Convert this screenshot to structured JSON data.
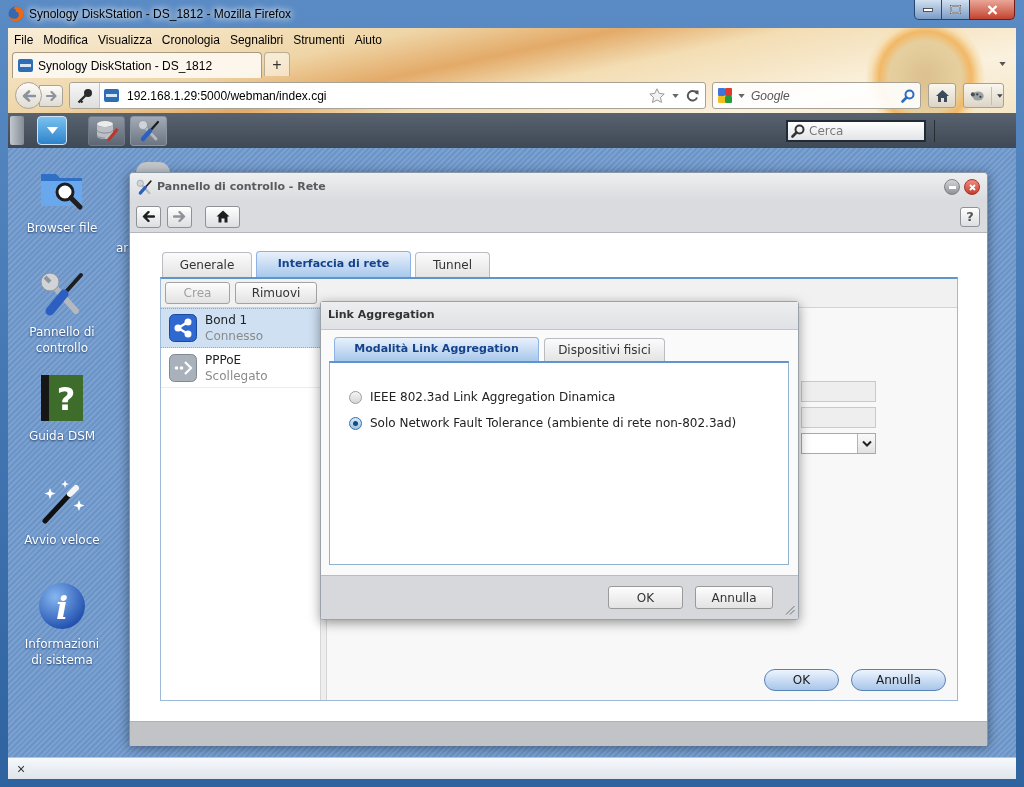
{
  "window": {
    "title": "Synology DiskStation - DS_1812 - Mozilla Firefox"
  },
  "menu_bar": [
    "File",
    "Modifica",
    "Visualizza",
    "Cronologia",
    "Segnalibri",
    "Strumenti",
    "Aiuto"
  ],
  "browser_tabs": [
    {
      "label": "Synology DiskStation - DS_1812",
      "selected": true
    }
  ],
  "new_tab_button": "+",
  "address_bar": {
    "value": "192.168.1.29:5000/webman/index.cgi"
  },
  "search_bar": {
    "placeholder": "Google"
  },
  "dsm_taskbar": {
    "search": {
      "placeholder": "Cerca"
    }
  },
  "desktop": {
    "icons": [
      {
        "kind": "files",
        "label": "Browser file"
      },
      {
        "kind": "tools",
        "label": "Pannello di controllo"
      },
      {
        "kind": "help",
        "label": "Guida DSM",
        "glyph": "?"
      },
      {
        "kind": "wizard",
        "label": "Avvio veloce"
      },
      {
        "kind": "info",
        "label": "Informazioni di sistema",
        "glyph": "i"
      }
    ],
    "covered_label": "ar"
  },
  "control_panel": {
    "title": "Pannello di controllo - Rete",
    "help_button": "?",
    "tabs": [
      {
        "label": "Generale",
        "selected": false
      },
      {
        "label": "Interfaccia di rete",
        "selected": true
      },
      {
        "label": "Tunnel",
        "selected": false
      }
    ],
    "toolbar": [
      {
        "label": "Crea",
        "disabled": true
      },
      {
        "label": "Rimuovi",
        "disabled": false
      }
    ],
    "interfaces": [
      {
        "kind": "bond",
        "name": "Bond 1",
        "status": "Connesso",
        "selected": true
      },
      {
        "kind": "pppoe",
        "name": "PPPoE",
        "status": "Scollegato",
        "selected": false
      }
    ],
    "fields": [
      {
        "kind": "text"
      },
      {
        "kind": "text"
      },
      {
        "kind": "select"
      }
    ],
    "buttons": [
      "OK",
      "Annulla"
    ]
  },
  "dialog": {
    "title": "Link Aggregation",
    "tabs": [
      {
        "label": "Modalità Link Aggregation",
        "selected": true
      },
      {
        "label": "Dispositivi fisici",
        "selected": false
      }
    ],
    "options": [
      {
        "label": "IEEE 802.3ad Link Aggregation Dinamica",
        "selected": false
      },
      {
        "label": "Solo Network Fault Tolerance (ambiente di rete non-802.3ad)",
        "selected": true
      }
    ],
    "buttons": [
      "OK",
      "Annulla"
    ]
  },
  "status_bar": {
    "close_button": "×"
  }
}
